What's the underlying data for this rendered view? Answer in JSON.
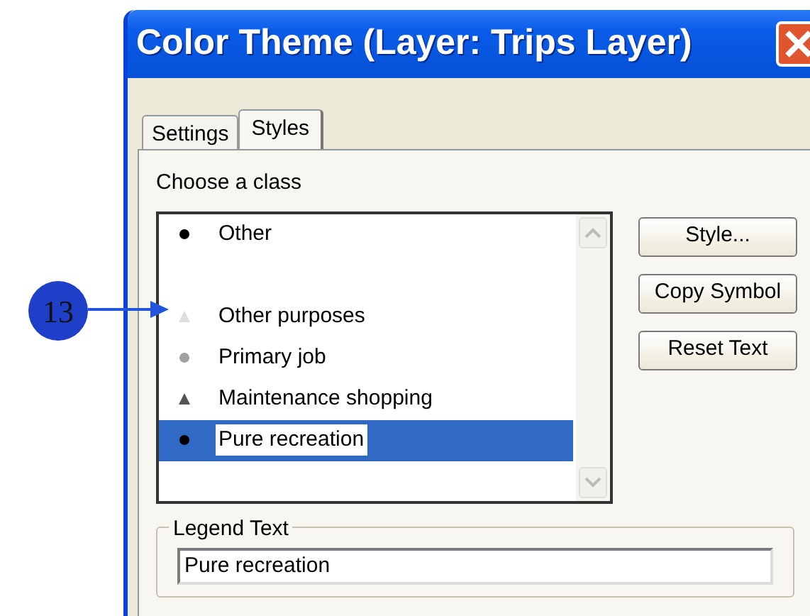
{
  "window": {
    "title": "Color Theme (Layer: Trips Layer)"
  },
  "callout": {
    "label": "13"
  },
  "tabs": [
    {
      "label": "Settings",
      "selected": false
    },
    {
      "label": "Styles",
      "selected": true
    }
  ],
  "class_list": {
    "label": "Choose a class",
    "items": [
      {
        "kind": "dot",
        "label": "Other",
        "color": "#000000",
        "selected": false
      },
      {
        "kind": "blank"
      },
      {
        "kind": "triangle",
        "label": "Other purposes",
        "color": "#dddddd",
        "selected": false
      },
      {
        "kind": "dot",
        "label": "Primary job",
        "color": "#a0a0a0",
        "selected": false
      },
      {
        "kind": "triangle",
        "label": "Maintenance shopping",
        "color": "#555555",
        "selected": false
      },
      {
        "kind": "dot",
        "label": "Pure recreation",
        "color": "#000000",
        "selected": true
      }
    ]
  },
  "buttons": [
    "Style...",
    "Copy Symbol",
    "Reset Text"
  ],
  "legend": {
    "label": "Legend Text",
    "value": "Pure recreation"
  }
}
